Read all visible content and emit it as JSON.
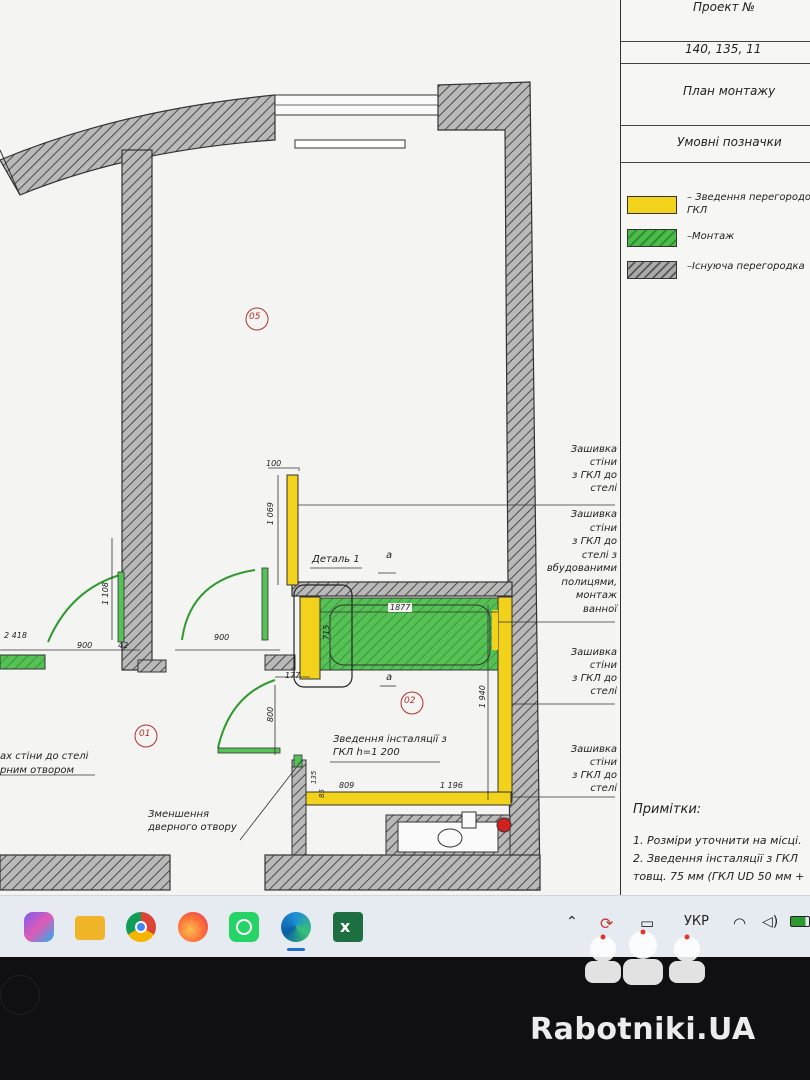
{
  "panel": {
    "project_label": "Проект №",
    "project_number": "140, 135, 11",
    "plan_title": "План монтажу",
    "legend_title": "Умовні позначки",
    "legend": [
      {
        "line1": "– Зведення перегородок",
        "line2": "ГКЛ",
        "color": "#f2d21b"
      },
      {
        "line1": "–Монтаж",
        "line2": "",
        "color": "#3ea63e"
      },
      {
        "line1": "–Існуюча перегородка",
        "line2": "",
        "color": "#8c8c8c"
      }
    ],
    "notes_title": "Примітки:",
    "note1": "1. Розміри уточнити на місці.",
    "note2a": "2. Зведення інсталяції з ГКЛ",
    "note2b": "товщ. 75 мм (ГКЛ UD 50 мм +"
  },
  "drawing": {
    "room_05": "05",
    "room_02": "02",
    "room_01": "01",
    "callout_1": [
      "Зашивка",
      "стіни",
      "з ГКЛ до",
      "стелі"
    ],
    "callout_2": [
      "Зашивка",
      "стіни",
      "з ГКЛ до",
      "стелі з",
      "вбудованими",
      "полицями,",
      "монтаж",
      "ванної"
    ],
    "callout_3": [
      "Зашивка",
      "стіни",
      "з ГКЛ до",
      "стелі"
    ],
    "callout_4": [
      "Зашивка",
      "стіни",
      "з ГКЛ до",
      "стелі"
    ],
    "detail_label": "Деталь 1",
    "section_a_top": "a",
    "section_a_bottom": "a",
    "installation_line1": "Зведення інсталяції з",
    "installation_line2": "ГКЛ  h=1 200",
    "door_reduce_line1": "Зменшення",
    "door_reduce_line2": "дверного отвору",
    "left_note_line1": "ах стіни до стелі",
    "left_note_line2": "рним отвором",
    "dims": {
      "d100": "100",
      "d1069": "1 069",
      "d1108": "1 108",
      "d2418": "2 418",
      "d900a": "900",
      "d42": "42",
      "d900b": "900",
      "d1877": "1877",
      "d715": "715",
      "d177": "177",
      "d800": "800",
      "d1940": "1 940",
      "d809": "809",
      "d1196": "1 196",
      "d135": "135",
      "d85": "85"
    }
  },
  "taskbar": {
    "apps": [
      {
        "name": "copilot",
        "color": "#7a5cf0"
      },
      {
        "name": "file-explorer",
        "color": "#f0b429"
      },
      {
        "name": "chrome",
        "color": "#db4437"
      },
      {
        "name": "firefox",
        "color": "#ff7139"
      },
      {
        "name": "whatsapp",
        "color": "#25d366"
      },
      {
        "name": "edge",
        "color": "#1f8fd6"
      },
      {
        "name": "excel",
        "color": "#1d6f42"
      }
    ],
    "language": "УКР"
  },
  "watermark": {
    "text": "Rabotniki.UA"
  }
}
